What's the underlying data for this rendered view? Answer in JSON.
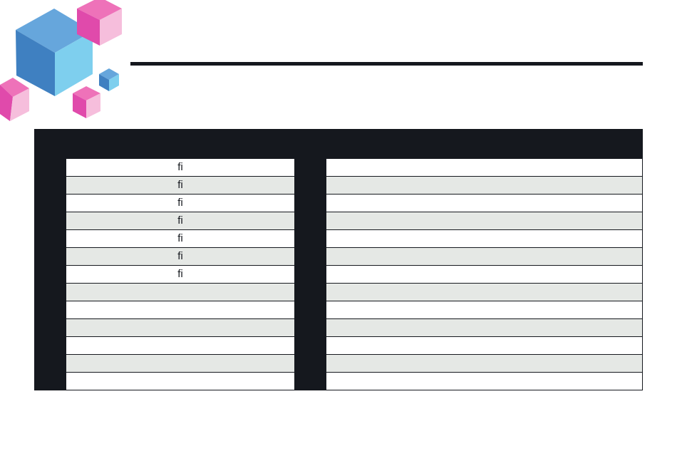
{
  "decor": {
    "logo": "cube-cluster-icon",
    "colors": {
      "blue_light": "#7ecfee",
      "blue_mid": "#66a6dc",
      "blue_dark": "#3f80c1",
      "pink_light": "#f6bedc",
      "pink_mid": "#ee72b9",
      "pink_dark": "#e04aab",
      "ink": "#15181e",
      "row_alt": "#e5e8e5"
    }
  },
  "table": {
    "rows": [
      {
        "c2": "ﬁ"
      },
      {
        "c2": "ﬁ"
      },
      {
        "c2": "ﬁ"
      },
      {
        "c2": "ﬁ"
      },
      {
        "c2": "ﬁ"
      },
      {
        "c2": "ﬁ"
      },
      {
        "c2": "ﬁ"
      },
      {
        "c2": ""
      },
      {
        "c2": ""
      },
      {
        "c2": ""
      },
      {
        "c2": ""
      },
      {
        "c2": ""
      },
      {
        "c2": ""
      }
    ]
  }
}
